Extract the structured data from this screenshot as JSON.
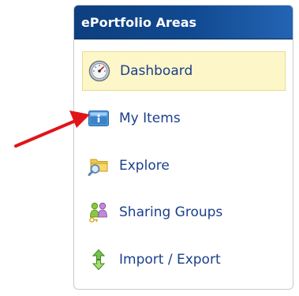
{
  "panel": {
    "title": "ePortfolio Areas",
    "items": [
      {
        "label": "Dashboard",
        "icon": "dashboard-gauge-icon",
        "active": true
      },
      {
        "label": "My Items",
        "icon": "my-items-info-icon",
        "active": false
      },
      {
        "label": "Explore",
        "icon": "explore-folder-magnifier-icon",
        "active": false
      },
      {
        "label": "Sharing Groups",
        "icon": "sharing-groups-people-icon",
        "active": false
      },
      {
        "label": "Import / Export",
        "icon": "import-export-arrows-icon",
        "active": false
      }
    ]
  },
  "colors": {
    "header_bg": "#114a92",
    "header_text": "#ffffff",
    "link_text": "#1a3f8c",
    "active_bg": "#fdf6c8",
    "active_border": "#ecd98c",
    "annotation_arrow": "#e0151b"
  }
}
